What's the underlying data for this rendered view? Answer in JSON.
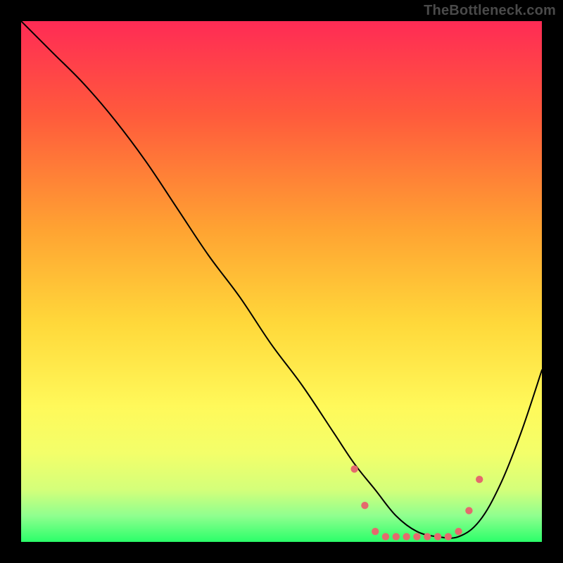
{
  "watermark": "TheBottleneck.com",
  "chart_data": {
    "type": "line",
    "title": "",
    "xlabel": "",
    "ylabel": "",
    "xlim": [
      0,
      100
    ],
    "ylim": [
      0,
      100
    ],
    "grid": false,
    "gradient_stops": [
      {
        "offset": 0,
        "color": "#ff2b55"
      },
      {
        "offset": 18,
        "color": "#ff5a3c"
      },
      {
        "offset": 40,
        "color": "#ffa332"
      },
      {
        "offset": 58,
        "color": "#ffd83a"
      },
      {
        "offset": 74,
        "color": "#fff95a"
      },
      {
        "offset": 83,
        "color": "#f3ff6a"
      },
      {
        "offset": 90,
        "color": "#d4ff7a"
      },
      {
        "offset": 95,
        "color": "#8fff8f"
      },
      {
        "offset": 100,
        "color": "#2bff6a"
      }
    ],
    "series": [
      {
        "name": "bottleneck-curve",
        "color": "#000000",
        "stroke_width": 2,
        "x": [
          0,
          6,
          12,
          18,
          24,
          30,
          36,
          42,
          48,
          54,
          60,
          64,
          68,
          72,
          76,
          80,
          84,
          88,
          92,
          96,
          100
        ],
        "y": [
          100,
          94,
          88,
          81,
          73,
          64,
          55,
          47,
          38,
          30,
          21,
          15,
          10,
          5,
          2,
          1,
          1,
          4,
          11,
          21,
          33
        ]
      }
    ],
    "markers": {
      "name": "optimal-range",
      "color": "#e46a6d",
      "radius": 5.2,
      "points": [
        {
          "x": 64,
          "y": 14
        },
        {
          "x": 66,
          "y": 7
        },
        {
          "x": 68,
          "y": 2
        },
        {
          "x": 70,
          "y": 1
        },
        {
          "x": 72,
          "y": 1
        },
        {
          "x": 74,
          "y": 1
        },
        {
          "x": 76,
          "y": 1
        },
        {
          "x": 78,
          "y": 1
        },
        {
          "x": 80,
          "y": 1
        },
        {
          "x": 82,
          "y": 1
        },
        {
          "x": 84,
          "y": 2
        },
        {
          "x": 86,
          "y": 6
        },
        {
          "x": 88,
          "y": 12
        }
      ]
    }
  }
}
